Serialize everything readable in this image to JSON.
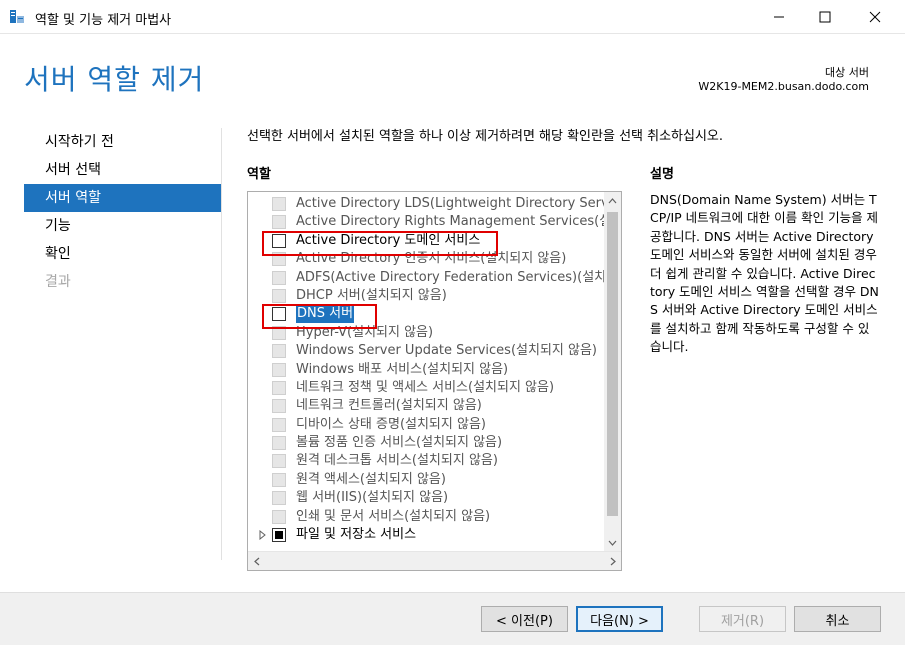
{
  "window": {
    "title": "역할 및 기능 제거 마법사",
    "minimize_glyph": "—",
    "maximize_glyph": "☐",
    "close_glyph": "✕"
  },
  "header": {
    "title": "서버 역할 제거",
    "destination_label": "대상 서버",
    "destination_server": "W2K19-MEM2.busan.dodo.com"
  },
  "nav": {
    "items": [
      {
        "label": "시작하기 전",
        "state": "normal"
      },
      {
        "label": "서버 선택",
        "state": "normal"
      },
      {
        "label": "서버 역할",
        "state": "active"
      },
      {
        "label": "기능",
        "state": "normal"
      },
      {
        "label": "확인",
        "state": "normal"
      },
      {
        "label": "결과",
        "state": "disabled"
      }
    ]
  },
  "main": {
    "instruction": "선택한 서버에서 설치된 역할을 하나 이상 제거하려면 해당 확인란을 선택 취소하십시오.",
    "roles_heading": "역할",
    "description_heading": "설명",
    "roles": [
      {
        "label": "Active Directory LDS(Lightweight Directory Servic",
        "checkbox": "disabled",
        "style": "grey"
      },
      {
        "label": "Active Directory Rights Management Services(설",
        "checkbox": "disabled",
        "style": "grey"
      },
      {
        "label": "Active Directory 도메인 서비스",
        "checkbox": "enabled",
        "style": "dark"
      },
      {
        "label": "Active Directory 인증서 서비스(설치되지 않음)",
        "checkbox": "disabled",
        "style": "grey"
      },
      {
        "label": "ADFS(Active Directory Federation Services)(설치되",
        "checkbox": "disabled",
        "style": "grey"
      },
      {
        "label": "DHCP 서버(설치되지 않음)",
        "checkbox": "disabled",
        "style": "grey"
      },
      {
        "label": "DNS 서버",
        "checkbox": "enabled",
        "style": "selected"
      },
      {
        "label": "Hyper-V(설치되지 않음)",
        "checkbox": "disabled",
        "style": "grey"
      },
      {
        "label": "Windows Server Update Services(설치되지 않음)",
        "checkbox": "disabled",
        "style": "grey"
      },
      {
        "label": "Windows 배포 서비스(설치되지 않음)",
        "checkbox": "disabled",
        "style": "grey"
      },
      {
        "label": "네트워크 정책 및 액세스 서비스(설치되지 않음)",
        "checkbox": "disabled",
        "style": "grey"
      },
      {
        "label": "네트워크 컨트롤러(설치되지 않음)",
        "checkbox": "disabled",
        "style": "grey"
      },
      {
        "label": "디바이스 상태 증명(설치되지 않음)",
        "checkbox": "disabled",
        "style": "grey"
      },
      {
        "label": "볼륨 정품 인증 서비스(설치되지 않음)",
        "checkbox": "disabled",
        "style": "grey"
      },
      {
        "label": "원격 데스크톱 서비스(설치되지 않음)",
        "checkbox": "disabled",
        "style": "grey"
      },
      {
        "label": "원격 액세스(설치되지 않음)",
        "checkbox": "disabled",
        "style": "grey"
      },
      {
        "label": "웹 서버(IIS)(설치되지 않음)",
        "checkbox": "disabled",
        "style": "grey"
      },
      {
        "label": "인쇄 및 문서 서비스(설치되지 않음)",
        "checkbox": "disabled",
        "style": "grey"
      },
      {
        "label": "파일 및 저장소 서비스",
        "checkbox": "partial",
        "style": "dark",
        "expander": true
      }
    ],
    "description": "DNS(Domain Name System) 서버는 TCP/IP 네트워크에 대한 이름 확인 기능을 제공합니다. DNS 서버는 Active Directory 도메인 서비스와 동일한 서버에 설치된 경우 더 쉽게 관리할 수 있습니다. Active Directory 도메인 서비스 역할을 선택할 경우 DNS 서버와 Active Directory 도메인 서비스를 설치하고 함께 작동하도록 구성할 수 있습니다."
  },
  "footer": {
    "prev_label": "< 이전(P)",
    "next_label": "다음(N) >",
    "remove_label": "제거(R)",
    "cancel_label": "취소"
  },
  "colors": {
    "accent": "#1e73be",
    "highlight_box": "#e00000"
  }
}
